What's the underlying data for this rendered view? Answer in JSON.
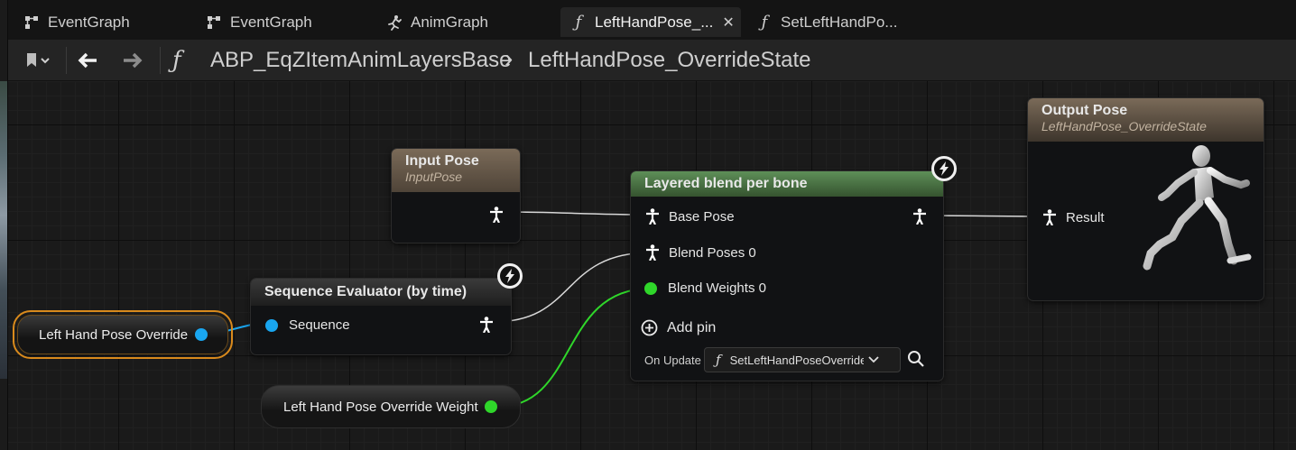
{
  "tabs": [
    {
      "label": "EventGraph",
      "icon": "event-graph-icon"
    },
    {
      "label": "EventGraph",
      "icon": "event-graph-icon"
    },
    {
      "label": "AnimGraph",
      "icon": "anim-graph-icon"
    },
    {
      "label": "LeftHandPose_...",
      "icon": "function-icon",
      "close": "✕"
    },
    {
      "label": "SetLeftHandPo...",
      "icon": "function-icon"
    }
  ],
  "toolbar": {
    "function_glyph": "ƒ",
    "breadcrumb_root": "ABP_EqZItemAnimLayersBase",
    "breadcrumb_separator": "›",
    "breadcrumb_current": "LeftHandPose_OverrideState"
  },
  "nodes": {
    "input_pose": {
      "title": "Input Pose",
      "subtitle": "InputPose"
    },
    "sequence_evaluator": {
      "title": "Sequence Evaluator (by time)",
      "pin_sequence": "Sequence"
    },
    "layered_blend": {
      "title": "Layered blend per bone",
      "pin_base_pose": "Base Pose",
      "pin_blend_poses": "Blend Poses 0",
      "pin_blend_weights": "Blend Weights 0",
      "add_pin": "Add pin",
      "on_update_label": "On Update",
      "on_update_value": "SetLeftHandPoseOverride"
    },
    "output_pose": {
      "title": "Output Pose",
      "subtitle": "LeftHandPose_OverrideState",
      "pin_result": "Result"
    }
  },
  "variables": {
    "left_hand_pose_override": "Left Hand Pose Override",
    "left_hand_pose_override_weight": "Left Hand Pose Override Weight"
  },
  "colors": {
    "blend_header": "#4a7a44",
    "pose_header": "#7a6a58",
    "bool_pin": "#19a6f0",
    "float_pin": "#2fd62a",
    "selected_outline": "#d98a1c"
  }
}
